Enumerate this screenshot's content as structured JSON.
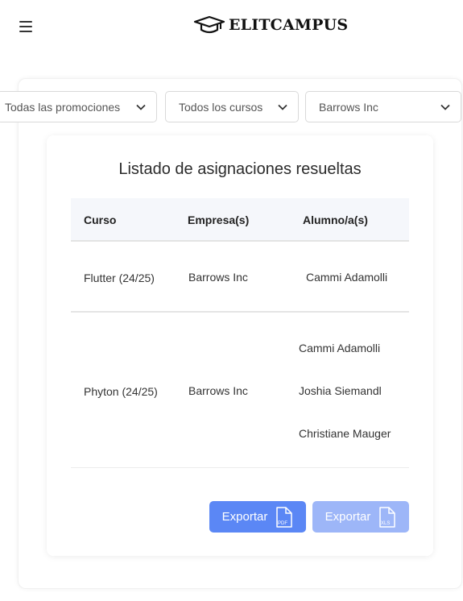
{
  "header": {
    "menu_icon": "hamburger-menu-icon",
    "logo_icon": "graduation-cap-icon",
    "brand": "ELITCAMPUS"
  },
  "filters": {
    "promotion": "Todas las promociones",
    "course": "Todos los cursos",
    "company": "Barrows Inc"
  },
  "card": {
    "title": "Listado de asignaciones resueltas",
    "columns": [
      "Curso",
      "Empresa(s)",
      "Alumno/a(s)"
    ],
    "rows": [
      {
        "course": "Flutter (24/25)",
        "company": "Barrows Inc",
        "students": [
          "Cammi Adamolli"
        ]
      },
      {
        "course": "Phyton (24/25)",
        "company": "Barrows Inc",
        "students": [
          "Cammi Adamolli",
          "Joshia Siemandl",
          "Christiane Mauger"
        ]
      }
    ]
  },
  "actions": {
    "export_pdf_label": "Exportar",
    "export_pdf_badge": "PDF",
    "export_xls_label": "Exportar",
    "export_xls_badge": "XLS"
  },
  "colors": {
    "accent": "#5b87f5",
    "accent_disabled": "#9db6f8",
    "table_header_bg": "#f5f7fb"
  }
}
